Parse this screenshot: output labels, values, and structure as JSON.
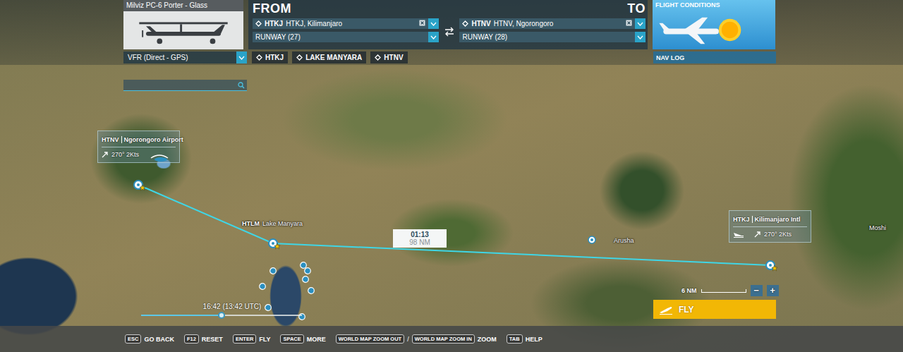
{
  "aircraft": {
    "name": "Milviz PC-6 Porter - Glass"
  },
  "from": {
    "title": "FROM",
    "code": "HTKJ",
    "name": "HTKJ, Kilimanjaro",
    "runway": "RUNWAY (27)"
  },
  "to": {
    "title": "TO",
    "code": "HTNV",
    "name": "HTNV, Ngorongoro",
    "runway": "RUNWAY (28)"
  },
  "flight_conditions": {
    "label": "FLIGHT CONDITIONS"
  },
  "flight_plan": {
    "type": "VFR (Direct - GPS)",
    "waypoints": [
      "HTKJ",
      "LAKE MANYARA",
      "HTNV"
    ]
  },
  "nav_log": "NAV LOG",
  "map": {
    "airports": [
      {
        "code": "HTNV",
        "name": "Ngorongoro Airport",
        "wind": "270° 2Kts",
        "kind": "card"
      },
      {
        "code": "HTLM",
        "name": "Lake Manyara",
        "wind": "",
        "kind": "label"
      },
      {
        "code": "HTKJ",
        "name": "Kilimanjaro Intl",
        "wind": "270° 2Kts",
        "kind": "card"
      }
    ],
    "cities": [
      {
        "name": "Arusha"
      },
      {
        "name": "Moshi"
      }
    ],
    "leg": {
      "time": "01:13",
      "distance": "98 NM"
    },
    "scale": "6 NM",
    "zoom_out": "−",
    "zoom_in": "+"
  },
  "time": {
    "label": "16:42 (13:42 UTC)",
    "level": 0.5
  },
  "fly_button": "FLY",
  "hints": [
    {
      "keys": [
        "ESC"
      ],
      "label": "GO BACK"
    },
    {
      "keys": [
        "F12"
      ],
      "label": "RESET"
    },
    {
      "keys": [
        "ENTER"
      ],
      "label": "FLY"
    },
    {
      "keys": [
        "SPACE"
      ],
      "label": "MORE"
    },
    {
      "keys": [
        "WORLD MAP ZOOM OUT",
        "/",
        "WORLD MAP ZOOM IN"
      ],
      "label": "ZOOM"
    },
    {
      "keys": [
        "TAB"
      ],
      "label": "HELP"
    }
  ]
}
